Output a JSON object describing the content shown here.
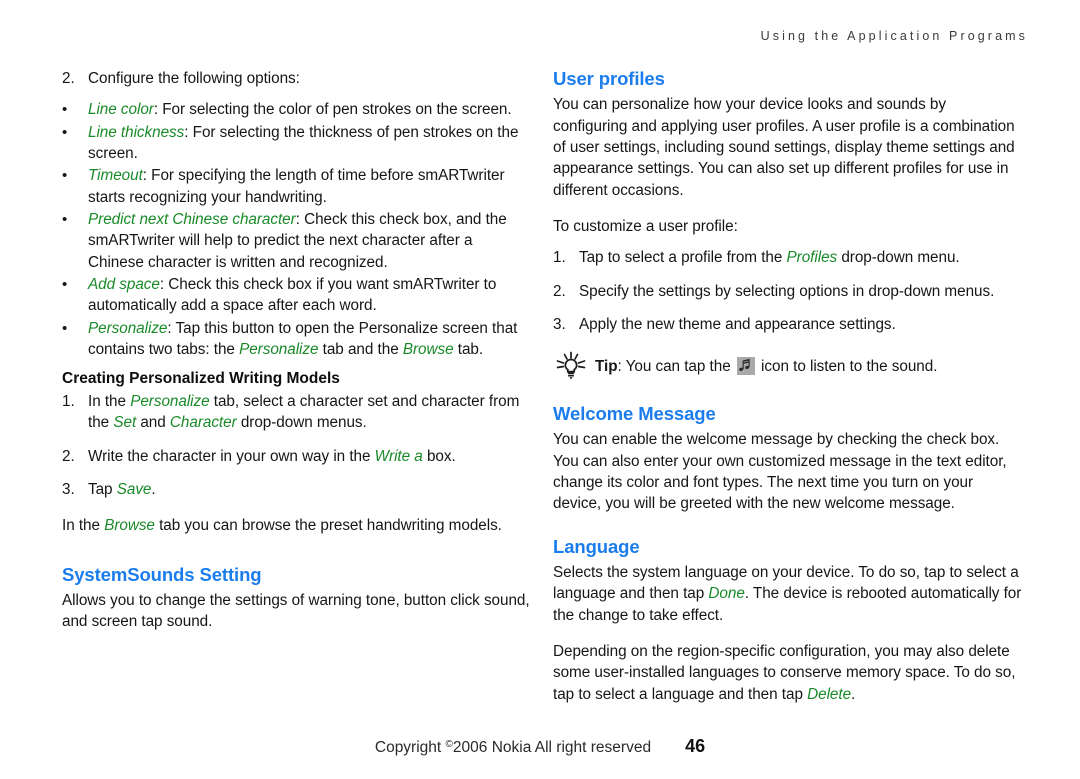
{
  "header": {
    "running_title": "Using the Application Programs"
  },
  "left_column": {
    "step2": {
      "marker": "2.",
      "text": "Configure the following options:"
    },
    "bullets": [
      {
        "marker": "•",
        "term": "Line color",
        "text": ": For selecting the color of pen strokes on the screen."
      },
      {
        "marker": "•",
        "term": "Line thickness",
        "text": ": For selecting the thickness of pen strokes on the screen."
      },
      {
        "marker": "•",
        "term": "Timeout",
        "text": ": For specifying the length of time before smARTwriter starts recognizing your handwriting."
      },
      {
        "marker": "•",
        "term": "Predict next Chinese character",
        "text": ": Check this check box, and the smARTwriter will help to predict the next character after a Chinese character is written and recognized."
      },
      {
        "marker": "•",
        "term": "Add space",
        "text": ": Check this check box if you want smARTwriter to automatically add a space after each word."
      }
    ],
    "personalize_bullet": {
      "marker": "•",
      "term": "Personalize",
      "text_before": ": Tap this button to open the Personalize screen that contains two tabs: the ",
      "term2": "Personalize",
      "text_mid": " tab and the ",
      "term3": "Browse",
      "text_after": " tab."
    },
    "subheading": "Creating Personalized Writing Models",
    "models_steps": [
      {
        "marker": "1.",
        "text_before": "In the ",
        "term1": "Personalize",
        "text_mid1": " tab, select a character set and character from the ",
        "term2": "Set",
        "text_mid2": " and ",
        "term3": "Character",
        "text_after": " drop-down menus."
      },
      {
        "marker": "2.",
        "text_before": "Write the character in your own way in the ",
        "term1": "Write a",
        "text_after": " box."
      },
      {
        "marker": "3.",
        "text_before": "Tap ",
        "term1": "Save",
        "text_after": "."
      }
    ],
    "browse_note": {
      "text_before": "In the ",
      "term": "Browse",
      "text_after": " tab you can browse the preset handwriting models."
    },
    "systemsounds": {
      "heading": "SystemSounds Setting",
      "body": "Allows you to change the settings of warning tone, button click sound, and screen tap sound."
    }
  },
  "right_column": {
    "user_profiles": {
      "heading": "User profiles",
      "body": "You can personalize how your device looks and sounds by configuring and applying user profiles. A user profile is a combination of user settings, including sound settings, display theme settings and appearance settings. You can also set up different profiles for use in different occasions.",
      "intro": "To customize a user profile:",
      "steps": [
        {
          "marker": "1.",
          "text_before": "Tap to select a profile from the ",
          "term1": "Profiles",
          "text_after": " drop-down menu."
        },
        {
          "marker": "2.",
          "text_before": "Specify the settings by selecting options in drop-down menus.",
          "term1": "",
          "text_after": ""
        },
        {
          "marker": "3.",
          "text_before": "Apply the new theme and appearance settings.",
          "term1": "",
          "text_after": ""
        }
      ]
    },
    "tip": {
      "label": "Tip",
      "text_before": ": You can tap the ",
      "text_after": " icon to listen to the sound."
    },
    "welcome_message": {
      "heading": "Welcome Message",
      "body": "You can enable the welcome message by checking the check box. You can also enter your own customized message in the text editor, change its color and font types. The next time you turn on your device, you will be greeted with the new welcome message."
    },
    "language": {
      "heading": "Language",
      "body_before": "Selects the system language on your device. To do so, tap to select a language and then tap ",
      "term1": "Done",
      "body_after": ". The device is rebooted automatically for the change to take effect.",
      "body2_before": "Depending on the region-specific configuration, you may also delete some user-installed languages to conserve memory space. To do so, tap to select a language and then tap ",
      "term2": "Delete",
      "body2_after": "."
    }
  },
  "footer": {
    "copyright": "Copyright ",
    "copyright_symbol": "©",
    "copyright_rest": "2006 Nokia All right reserved",
    "page_number": "46"
  },
  "colors": {
    "heading_blue": "#1b7ded",
    "emphasis_green": "#1a8a28",
    "body_black": "#161616",
    "icon_gray": "#a9a9a9"
  }
}
